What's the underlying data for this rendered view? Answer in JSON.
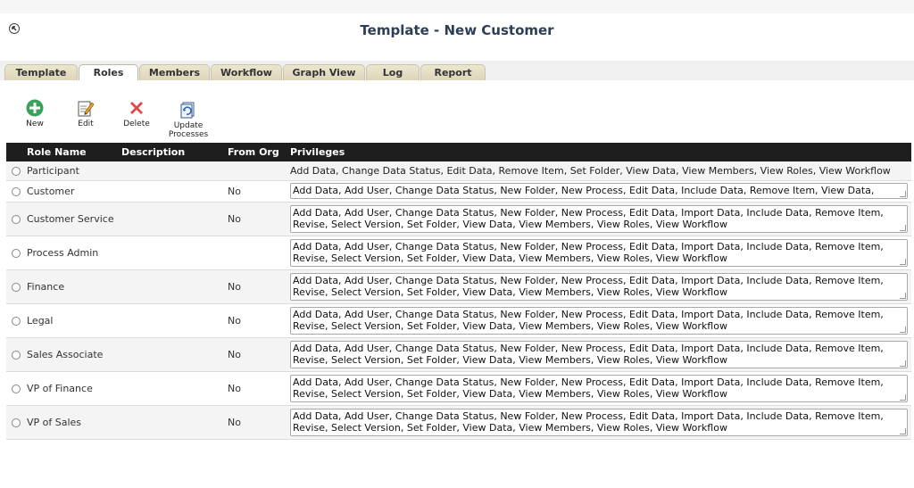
{
  "header": {
    "title": "Template - New Customer"
  },
  "tabs": [
    {
      "label": "Template",
      "active": false
    },
    {
      "label": "Roles",
      "active": true
    },
    {
      "label": "Members",
      "active": false
    },
    {
      "label": "Workflow",
      "active": false
    },
    {
      "label": "Graph View",
      "active": false
    },
    {
      "label": "Log",
      "active": false
    },
    {
      "label": "Report",
      "active": false
    }
  ],
  "toolbar": {
    "new_label": "New",
    "edit_label": "Edit",
    "delete_label": "Delete",
    "update_line1": "Update",
    "update_line2": "Processes"
  },
  "table": {
    "columns": [
      "Role Name",
      "Description",
      "From Org",
      "Privileges"
    ],
    "rows": [
      {
        "name": "Participant",
        "description": "",
        "from_org": "",
        "privileges": "Add Data, Change Data Status, Edit Data, Remove Item, Set Folder, View Data, View Members, View Roles, View Workflow"
      },
      {
        "name": "Customer",
        "description": "",
        "from_org": "No",
        "privileges": "Add Data, Add User, Change Data Status, New Folder, New Process, Edit Data, Include Data, Remove Item, View Data,"
      },
      {
        "name": "Customer Service",
        "description": "",
        "from_org": "No",
        "privileges": "Add Data, Add User, Change Data Status, New Folder, New Process, Edit Data, Import Data, Include Data, Remove Item, Revise, Select Version, Set Folder, View Data, View Members, View Roles, View Workflow"
      },
      {
        "name": "Process Admin",
        "description": "",
        "from_org": "",
        "privileges": "Add Data, Add User, Change Data Status, New Folder, New Process, Edit Data, Import Data, Include Data, Remove Item, Revise, Select Version, Set Folder, View Data, View Members, View Roles, View Workflow"
      },
      {
        "name": "Finance",
        "description": "",
        "from_org": "No",
        "privileges": "Add Data, Add User, Change Data Status, New Folder, New Process, Edit Data, Import Data, Include Data, Remove Item, Revise, Select Version, Set Folder, View Data, View Members, View Roles, View Workflow"
      },
      {
        "name": "Legal",
        "description": "",
        "from_org": "No",
        "privileges": "Add Data, Add User, Change Data Status, New Folder, New Process, Edit Data, Import Data, Include Data, Remove Item, Revise, Select Version, Set Folder, View Data, View Members, View Roles, View Workflow"
      },
      {
        "name": "Sales Associate",
        "description": "",
        "from_org": "No",
        "privileges": "Add Data, Add User, Change Data Status, New Folder, New Process, Edit Data, Import Data, Include Data, Remove Item, Revise, Select Version, Set Folder, View Data, View Members, View Roles, View Workflow"
      },
      {
        "name": "VP of Finance",
        "description": "",
        "from_org": "No",
        "privileges": "Add Data, Add User, Change Data Status, New Folder, New Process, Edit Data, Import Data, Include Data, Remove Item, Revise, Select Version, Set Folder, View Data, View Members, View Roles, View Workflow"
      },
      {
        "name": "VP of Sales",
        "description": "",
        "from_org": "No",
        "privileges": "Add Data, Add User, Change Data Status, New Folder, New Process, Edit Data, Import Data, Include Data, Remove Item, Revise, Select Version, Set Folder, View Data, View Members, View Roles, View Workflow"
      }
    ]
  },
  "icons": {
    "back": "back-arrow-icon",
    "new": "plus-circle-icon",
    "edit": "pencil-note-icon",
    "delete": "red-x-icon",
    "update": "update-processes-icon"
  },
  "colors": {
    "title": "#2e3e55",
    "header_row": "#1e1e1e",
    "new_icon": "#3aa05a",
    "delete_icon": "#e04848",
    "tab_bg": "#ddd6ba"
  }
}
